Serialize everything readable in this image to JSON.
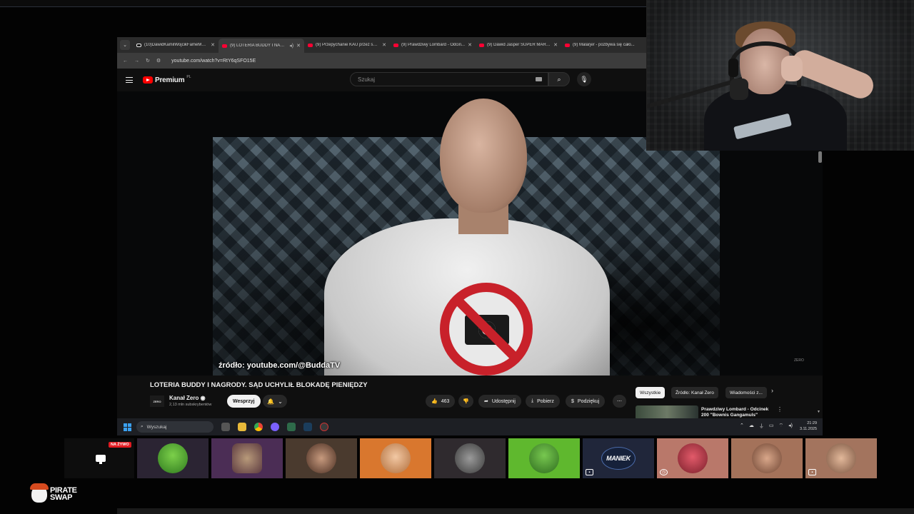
{
  "browser": {
    "tabs": [
      {
        "title": "(10)DawidKamilWojcikFameMM...",
        "favicon": "tiktok-icon",
        "active": false
      },
      {
        "title": "(9) LOTERIA BUDDY I NAGRO...",
        "favicon": "youtube-icon",
        "active": true
      },
      {
        "title": "(9) Przepychanie KAU przez sym...",
        "favicon": "youtube-icon",
        "active": false
      },
      {
        "title": "(9) Prawdziwy Lombard - Odcin...",
        "favicon": "youtube-icon",
        "active": false
      },
      {
        "title": "(9) Dawid Jasper SUPER MARKE...",
        "favicon": "youtube-icon",
        "active": false
      },
      {
        "title": "(9) Malarjer - pozbywa się cało...",
        "favicon": "youtube-icon",
        "active": false
      }
    ],
    "url": "youtube.com/watch?v=RtY6qSFO15E"
  },
  "youtube": {
    "logo_text": "Premium",
    "logo_region": "PL",
    "search_placeholder": "Szukaj"
  },
  "video": {
    "caption": "źródło: youtube.com/@BuddaTV",
    "watermark": "ZERO",
    "title": "LOTERIA BUDDY I NAGRODY. SĄD UCHYLIŁ BLOKADĘ PIENIĘDZY",
    "channel": {
      "avatar_text": "ZERO",
      "name": "Kanał Zero",
      "subscribers": "2,13 mln subskrybentów"
    },
    "support_label": "Wesprzyj",
    "likes": "463",
    "share_label": "Udostępnij",
    "download_label": "Pobierz",
    "thanks_label": "Podziękuj"
  },
  "recommendations": {
    "chips": [
      "Wszystkie",
      "Źródło: Kanał Zero",
      "Wiadomości z..."
    ],
    "first_title": "Prawdziwy Lombard - Odcinek 200 \"Bownis Gangamuls\""
  },
  "taskbar": {
    "search_placeholder": "Wyszukaj",
    "time": "21:29",
    "date": "3.11.2025"
  },
  "overlay": {
    "live_badge": "NA ŻYWO",
    "emote_label": "MANIEK",
    "brand_line1": "PIRATE",
    "brand_line2": "SWAP"
  },
  "colors": {
    "youtube_red": "#ff0000",
    "live_red": "#e11b22",
    "background": "#0f0f0f"
  }
}
